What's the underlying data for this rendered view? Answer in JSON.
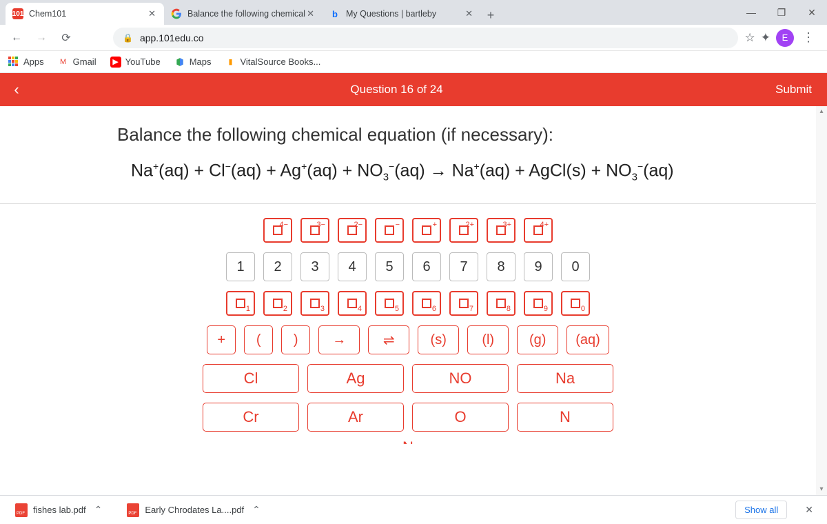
{
  "tabs": [
    {
      "favicon_text": "101",
      "title": "Chem101"
    },
    {
      "favicon_text": "G",
      "title": "Balance the following chemical"
    },
    {
      "favicon_text": "b",
      "title": "My Questions | bartleby"
    }
  ],
  "address_url": "app.101edu.co",
  "avatar_letter": "E",
  "bookmarks": {
    "apps": "Apps",
    "gmail": "Gmail",
    "youtube": "YouTube",
    "maps": "Maps",
    "vitalsource": "VitalSource Books..."
  },
  "app": {
    "question_label": "Question 16 of 24",
    "submit": "Submit",
    "prompt": "Balance the following chemical equation (if necessary):"
  },
  "keypad": {
    "charges": [
      "4−",
      "3−",
      "2−",
      "−",
      "+",
      "2+",
      "3+",
      "4+"
    ],
    "numbers": [
      "1",
      "2",
      "3",
      "4",
      "5",
      "6",
      "7",
      "8",
      "9",
      "0"
    ],
    "subscripts": [
      "1",
      "2",
      "3",
      "4",
      "5",
      "6",
      "7",
      "8",
      "9",
      "0"
    ],
    "symbols": {
      "plus": "+",
      "lparen": "(",
      "rparen": ")",
      "arrow": "→",
      "revarrow": "⇌",
      "s": "(s)",
      "l": "(l)",
      "g": "(g)",
      "aq": "(aq)"
    },
    "elements_row1": [
      "Cl",
      "Ag",
      "NO",
      "Na"
    ],
    "elements_row2": [
      "Cr",
      "Ar",
      "O",
      "N"
    ],
    "cutoff": "N"
  },
  "downloads": {
    "items": [
      "fishes lab.pdf",
      "Early Chrodates La....pdf"
    ],
    "show_all": "Show all"
  }
}
